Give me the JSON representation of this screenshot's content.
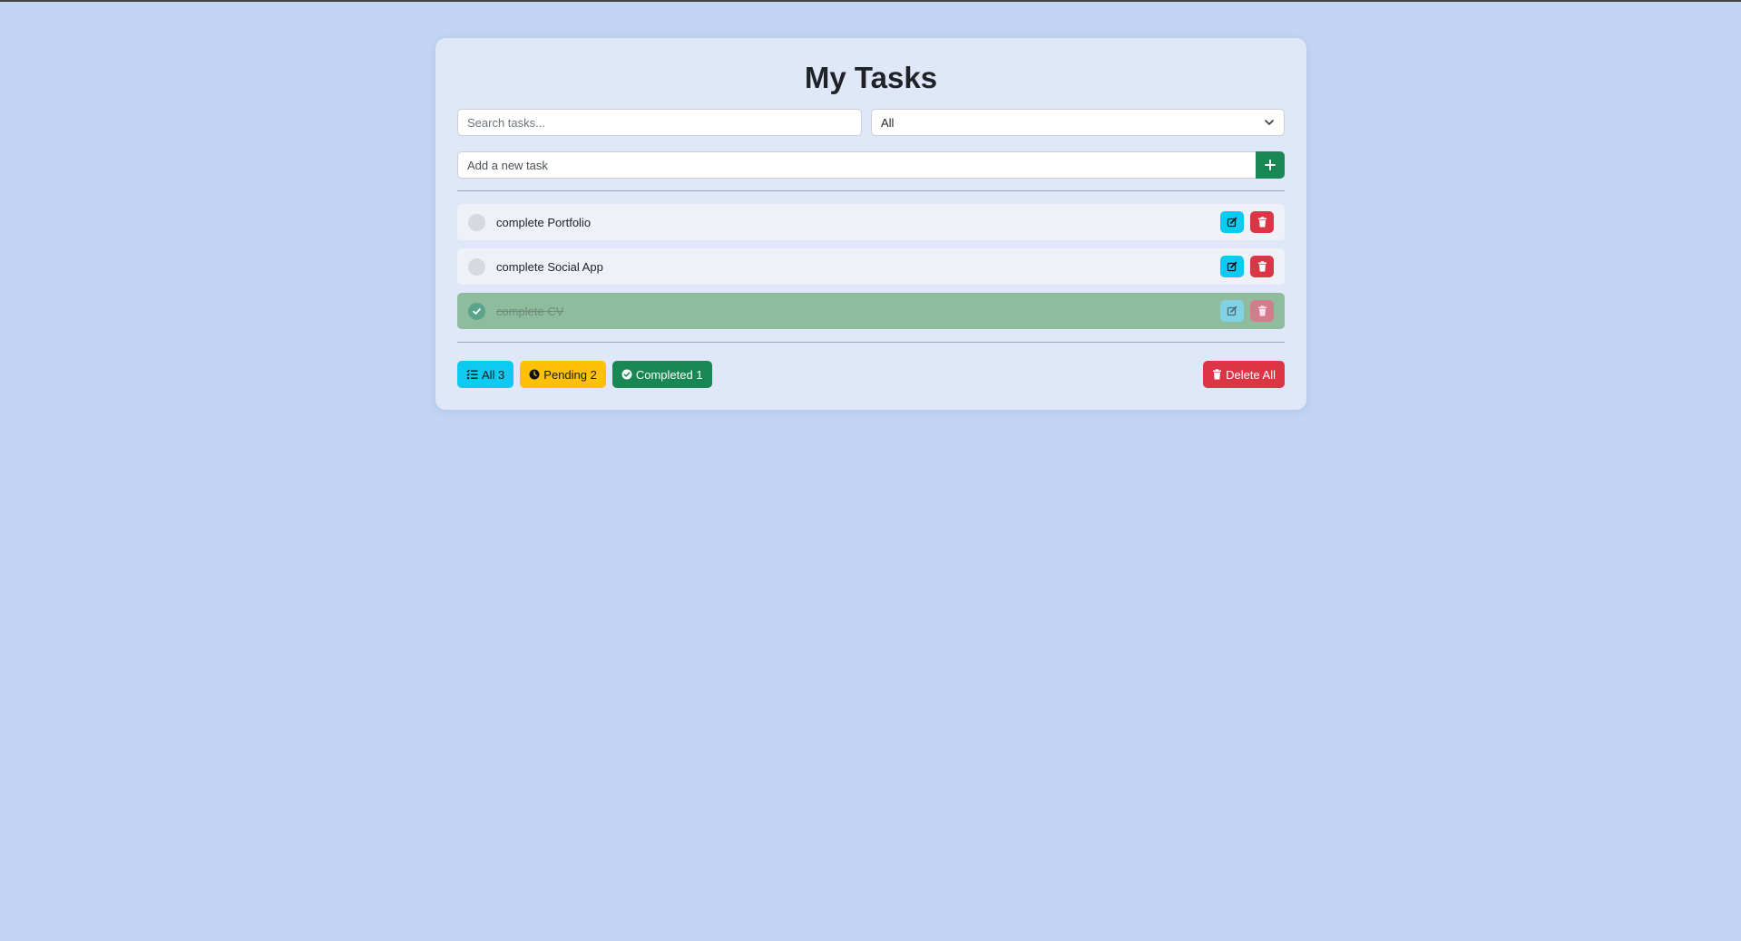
{
  "app": {
    "title": "My Tasks"
  },
  "search": {
    "placeholder": "Search tasks...",
    "value": ""
  },
  "filter": {
    "selected": "All",
    "options": [
      "All"
    ]
  },
  "add_task": {
    "placeholder": "Add a new task",
    "button_icon": "plus-icon"
  },
  "tasks": [
    {
      "text": "complete Portfolio",
      "completed": false
    },
    {
      "text": "complete Social App",
      "completed": false
    },
    {
      "text": "complete CV",
      "completed": true
    }
  ],
  "footer": {
    "all_label": "All 3",
    "pending_label": "Pending 2",
    "completed_label": "Completed 1",
    "delete_all_label": "Delete All"
  },
  "colors": {
    "background": "#c1d5f2",
    "card": "#dfe7f8",
    "add": "#198754",
    "edit": "#0dcaf0",
    "delete": "#dc3545",
    "pending": "#ffc107",
    "completed_row": "#8fbc9c"
  }
}
